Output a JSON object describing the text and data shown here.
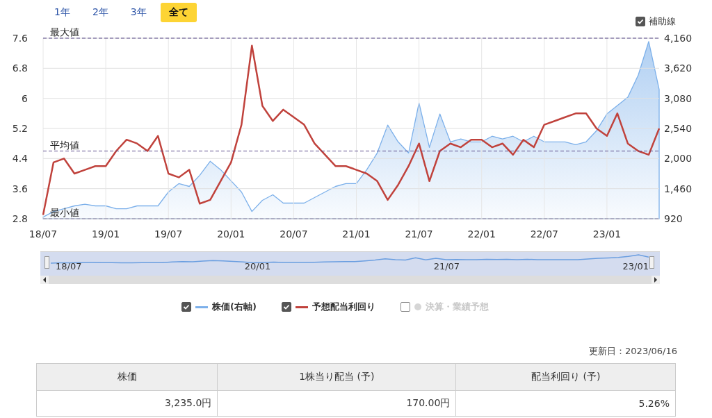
{
  "range_tabs": [
    {
      "label": "1年",
      "selected": false
    },
    {
      "label": "2年",
      "selected": false
    },
    {
      "label": "3年",
      "selected": false
    },
    {
      "label": "全て",
      "selected": true
    }
  ],
  "guide_toggle": {
    "label": "補助線",
    "checked": true
  },
  "chart": {
    "price": {
      "chart_data": {
        "type": "area",
        "categories": [
          null,
          null,
          null,
          null,
          null,
          null,
          null,
          null,
          null,
          null,
          null,
          null,
          null,
          null,
          null,
          null,
          null,
          null,
          null,
          null,
          null,
          null,
          null,
          null,
          null,
          null,
          null,
          null,
          null,
          null,
          null,
          null,
          null,
          null,
          null,
          null,
          null,
          null,
          null,
          null,
          null,
          null,
          null,
          null,
          null,
          null,
          null,
          null,
          null,
          null,
          null,
          null,
          null,
          null,
          null,
          null,
          null,
          null,
          null,
          null
        ],
        "series": [
          {
            "color": "#7cb0ea",
            "values": [
              950,
              1050,
              1100,
              1150,
              1180,
              1150,
              1150,
              1100,
              1100,
              1150,
              1150,
              1150,
              1400,
              1550,
              1500,
              1700,
              1950,
              1800,
              1600,
              1400,
              1050,
              1250,
              1350,
              1200,
              1200,
              1200,
              1300,
              1400,
              1500,
              1550,
              1550,
              1800,
              2100,
              2600,
              2300,
              2100,
              3000,
              2200,
              2800,
              2300,
              2350,
              2300,
              2300,
              2400,
              2350,
              2400,
              2300,
              2400,
              2300,
              2300,
              2300,
              2250,
              2300,
              2500,
              2800,
              2950,
              3100,
              3500,
              4100,
              3240
            ]
          }
        ],
        "ylim": [
          920,
          4160
        ],
        "yticks": [
          920,
          {
            "value": 1460,
            "label": "1,460"
          },
          {
            "value": 2000,
            "label": "2,000"
          },
          {
            "value": 2540,
            "label": "2,540"
          },
          {
            "value": 3080,
            "label": "3,080"
          },
          {
            "value": 3620,
            "label": "3,620"
          },
          {
            "value": 4160,
            "label": "4,160"
          }
        ]
      }
    },
    "yield": {
      "chart_data": {
        "type": "line",
        "categories": [
          "18/07",
          null,
          null,
          null,
          null,
          null,
          "19/01",
          null,
          null,
          null,
          null,
          null,
          "19/07",
          null,
          null,
          null,
          null,
          null,
          "20/01",
          null,
          null,
          null,
          null,
          null,
          "20/07",
          null,
          null,
          null,
          null,
          null,
          "21/01",
          null,
          null,
          null,
          null,
          null,
          "21/07",
          null,
          null,
          null,
          null,
          null,
          "22/01",
          null,
          null,
          null,
          null,
          null,
          "22/07",
          null,
          null,
          null,
          null,
          null,
          "23/01",
          null,
          null,
          null,
          null,
          null
        ],
        "series": [
          {
            "color": "#c0423c",
            "values": [
              2.9,
              4.3,
              4.4,
              4.0,
              4.1,
              4.2,
              4.2,
              4.6,
              4.9,
              4.8,
              4.6,
              5.0,
              4.0,
              3.9,
              4.1,
              3.2,
              3.3,
              3.8,
              4.3,
              5.3,
              7.4,
              5.8,
              5.4,
              5.7,
              5.5,
              5.3,
              4.8,
              4.5,
              4.2,
              4.2,
              4.1,
              4.0,
              3.8,
              3.3,
              3.7,
              4.2,
              4.8,
              3.8,
              4.6,
              4.8,
              4.7,
              4.9,
              4.9,
              4.7,
              4.8,
              4.5,
              4.9,
              4.7,
              5.3,
              5.4,
              5.5,
              5.6,
              5.6,
              5.2,
              5.0,
              5.6,
              4.8,
              4.6,
              4.5,
              5.2
            ]
          }
        ],
        "ylim": [
          2.8,
          7.6
        ],
        "yticks": [
          2.8,
          3.6,
          4.4,
          5.2,
          6,
          6.8,
          7.6
        ],
        "grid": true,
        "ref_lines": [
          {
            "axis": "y",
            "value": 7.6,
            "label": "最大値"
          },
          {
            "axis": "y",
            "value": 4.6,
            "label": "平均値"
          },
          {
            "axis": "y",
            "value": 2.8,
            "label": "最小値"
          }
        ]
      }
    }
  },
  "navigator": {
    "labels": [
      "18/07",
      "20/01",
      "21/07",
      "23/01"
    ]
  },
  "legend": [
    {
      "label": "株価(右軸)",
      "kind": "line",
      "color": "#7cb0ea",
      "checked": true,
      "disabled": false
    },
    {
      "label": "予想配当利回り",
      "kind": "line",
      "color": "#c0423c",
      "checked": true,
      "disabled": false
    },
    {
      "label": "決算・業績予想",
      "kind": "dot",
      "color": "#d6d6d6",
      "checked": false,
      "disabled": true
    }
  ],
  "updated": "更新日：2023/06/16",
  "table": {
    "columns": [
      "株価",
      "1株当り配当 (予)",
      "配当利回り (予)"
    ],
    "rows": [
      [
        "3,235.0円",
        "170.00円",
        "5.26%"
      ]
    ]
  }
}
